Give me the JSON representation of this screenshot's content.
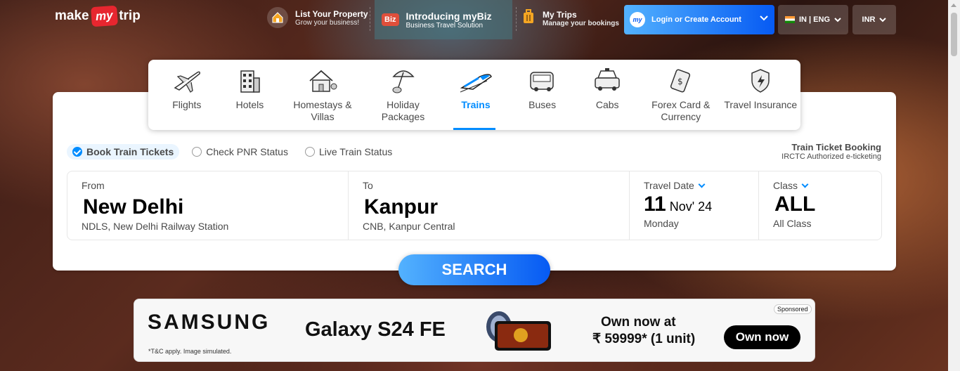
{
  "logo": {
    "make": "make",
    "my": "my",
    "trip": "trip"
  },
  "header": {
    "list_property": {
      "title": "List Your Property",
      "sub": "Grow your business!"
    },
    "mybiz": {
      "badge": "Biz",
      "title": "Introducing myBiz",
      "sub": "Business Travel Solution"
    },
    "my_trips": {
      "title": "My Trips",
      "sub": "Manage your bookings"
    },
    "login": {
      "badge": "my",
      "label": "Login or Create Account"
    },
    "locale": "IN | ENG",
    "currency": "INR"
  },
  "nav": {
    "items": [
      {
        "label": "Flights",
        "icon": "flight-icon"
      },
      {
        "label": "Hotels",
        "icon": "hotel-icon"
      },
      {
        "label": "Homestays & Villas",
        "icon": "homestay-icon"
      },
      {
        "label": "Holiday Packages",
        "icon": "holiday-icon"
      },
      {
        "label": "Trains",
        "icon": "train-icon",
        "active": true
      },
      {
        "label": "Buses",
        "icon": "bus-icon"
      },
      {
        "label": "Cabs",
        "icon": "cab-icon"
      },
      {
        "label": "Forex Card & Currency",
        "icon": "forex-icon"
      },
      {
        "label": "Travel Insurance",
        "icon": "insurance-icon"
      }
    ]
  },
  "options": {
    "book": "Book Train Tickets",
    "pnr": "Check PNR Status",
    "live": "Live Train Status",
    "selected": "Book Train Tickets"
  },
  "irctc": {
    "title": "Train Ticket Booking",
    "sub": "IRCTC Authorized e-ticketing"
  },
  "search": {
    "from": {
      "label": "From",
      "city": "New Delhi",
      "station": "NDLS, New Delhi Railway Station"
    },
    "to": {
      "label": "To",
      "city": "Kanpur",
      "station": "CNB, Kanpur Central"
    },
    "date": {
      "label": "Travel Date",
      "day": "11",
      "month": "Nov' 24",
      "weekday": "Monday"
    },
    "class": {
      "label": "Class",
      "value": "ALL",
      "sub": "All Class"
    },
    "button": "SEARCH"
  },
  "ad": {
    "brand": "SAMSUNG",
    "product": "Galaxy S24 FE",
    "note": "*T&C apply. Image simulated.",
    "offer_line1": "Own now at",
    "offer_line2": "₹ 59999* (1 unit)",
    "cta": "Own now",
    "sponsored": "Sponsored"
  },
  "colors": {
    "accent": "#008cff",
    "brand_red": "#e7262f",
    "button_start": "#53b2fe",
    "button_end": "#065af3"
  }
}
